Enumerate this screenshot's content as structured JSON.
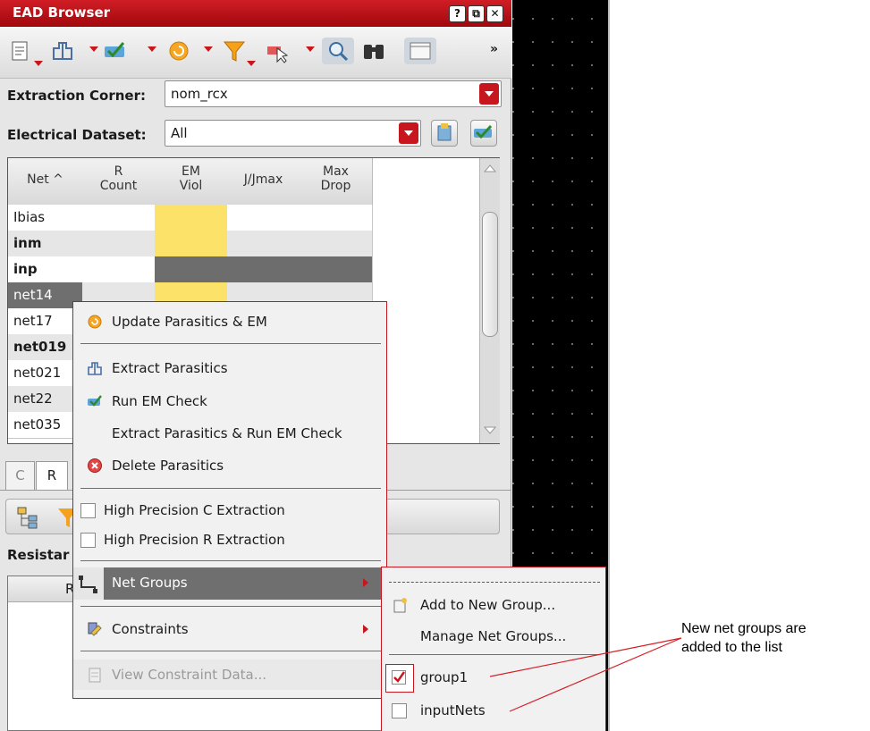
{
  "window": {
    "title": "EAD Browser",
    "controls": [
      "?",
      "⧉",
      "✕"
    ]
  },
  "toolbar": {
    "more": "»"
  },
  "extraction_corner": {
    "label": "Extraction Corner:",
    "value": "nom_rcx"
  },
  "electrical_dataset": {
    "label": "Electrical Dataset:",
    "value": "All"
  },
  "table": {
    "headers": [
      {
        "l1": "Net ^",
        "l2": ""
      },
      {
        "l1": "R",
        "l2": "Count"
      },
      {
        "l1": "EM",
        "l2": "Viol"
      },
      {
        "l1": "J/Jmax",
        "l2": ""
      },
      {
        "l1": "Max",
        "l2": "Drop"
      }
    ],
    "rows": [
      {
        "net": "Ibias"
      },
      {
        "net": "inm"
      },
      {
        "net": "inp"
      },
      {
        "net": "net14"
      },
      {
        "net": "net17"
      },
      {
        "net": "net019"
      },
      {
        "net": "net021"
      },
      {
        "net": "net22"
      },
      {
        "net": "net035"
      }
    ]
  },
  "lower": {
    "tabs": [
      "C",
      "R"
    ],
    "section_label": "Resistar",
    "column_header_fragment": "R"
  },
  "context_menu": {
    "update": "Update Parasitics & EM",
    "extract": "Extract Parasitics",
    "run_em": "Run EM Check",
    "extract_and_run": "Extract Parasitics & Run EM Check",
    "delete": "Delete Parasitics",
    "hp_c": "High Precision C Extraction",
    "hp_r": "High Precision R Extraction",
    "net_groups": "Net Groups",
    "constraints": "Constraints",
    "view_constraint": "View Constraint Data..."
  },
  "net_groups_submenu": {
    "add_new": "Add to New Group...",
    "manage": "Manage Net Groups...",
    "groups": [
      {
        "name": "group1",
        "checked": true
      },
      {
        "name": "inputNets",
        "checked": false
      }
    ]
  },
  "annotation": {
    "line1": "New net groups are",
    "line2": "added to the list"
  },
  "colors": {
    "accent": "#c8161e",
    "em_viol": "#fde26a",
    "dark_cell": "#6d6d6d",
    "selected": "#6f6f6f"
  }
}
